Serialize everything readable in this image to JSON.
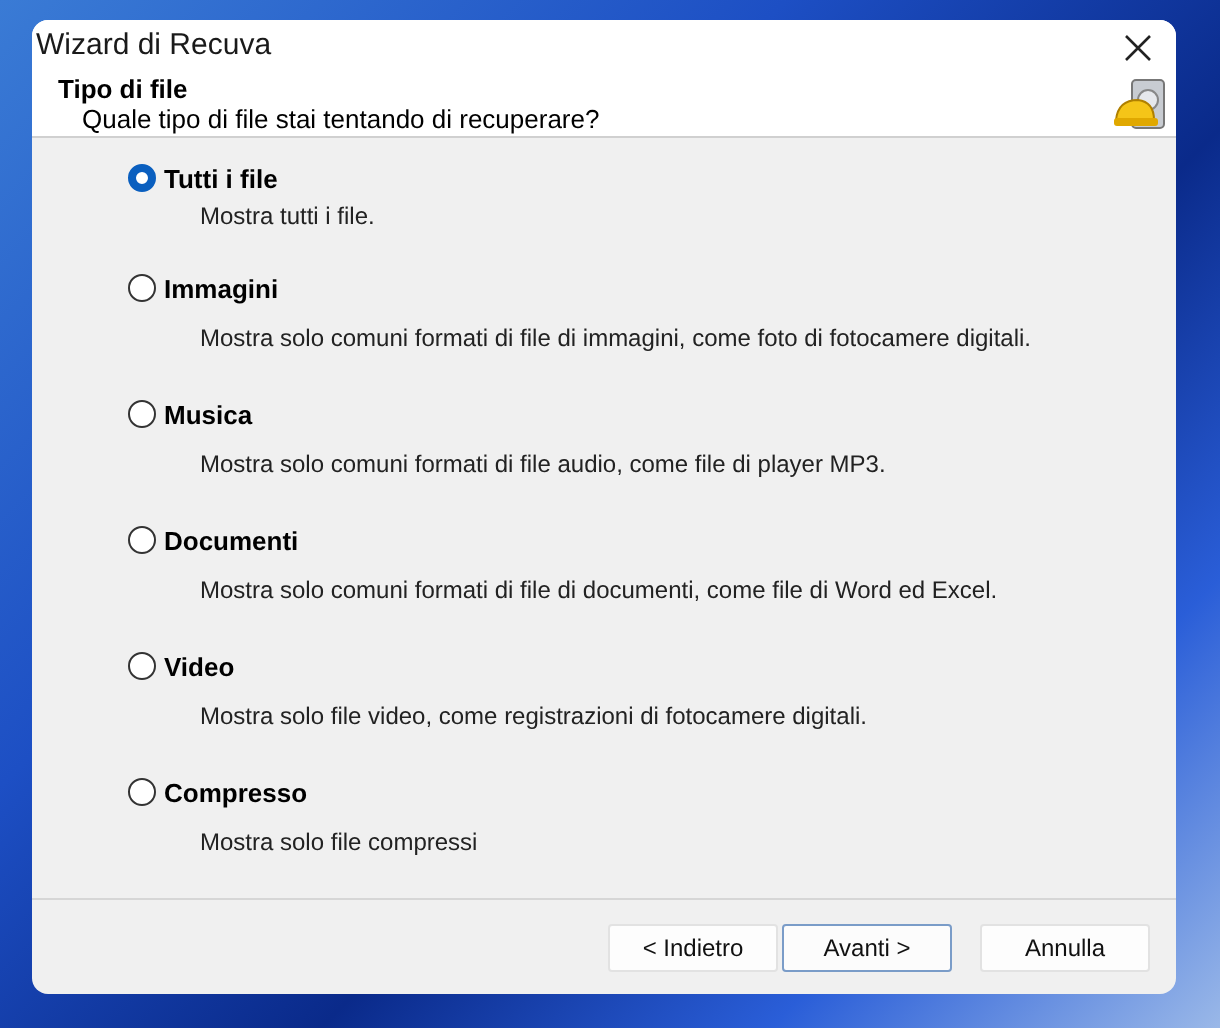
{
  "window": {
    "title": "Wizard di Recuva"
  },
  "header": {
    "title": "Tipo di file",
    "subtitle": "Quale tipo di file stai tentando di recuperare?"
  },
  "options": [
    {
      "label": "Tutti i file",
      "description": "Mostra tutti i file.",
      "selected": true
    },
    {
      "label": "Immagini",
      "description": "Mostra solo comuni formati di file di immagini, come foto di fotocamere digitali.",
      "selected": false
    },
    {
      "label": "Musica",
      "description": "Mostra solo comuni formati di file audio, come file di player MP3.",
      "selected": false
    },
    {
      "label": "Documenti",
      "description": "Mostra solo comuni formati di file di documenti, come file di Word ed Excel.",
      "selected": false
    },
    {
      "label": "Video",
      "description": "Mostra solo file video, come registrazioni di fotocamere digitali.",
      "selected": false
    },
    {
      "label": "Compresso",
      "description": "Mostra solo file compressi",
      "selected": false
    }
  ],
  "buttons": [
    {
      "label": "< Indietro",
      "default": false
    },
    {
      "label": "Avanti >",
      "default": true
    },
    {
      "label": "Annulla",
      "default": false
    }
  ]
}
